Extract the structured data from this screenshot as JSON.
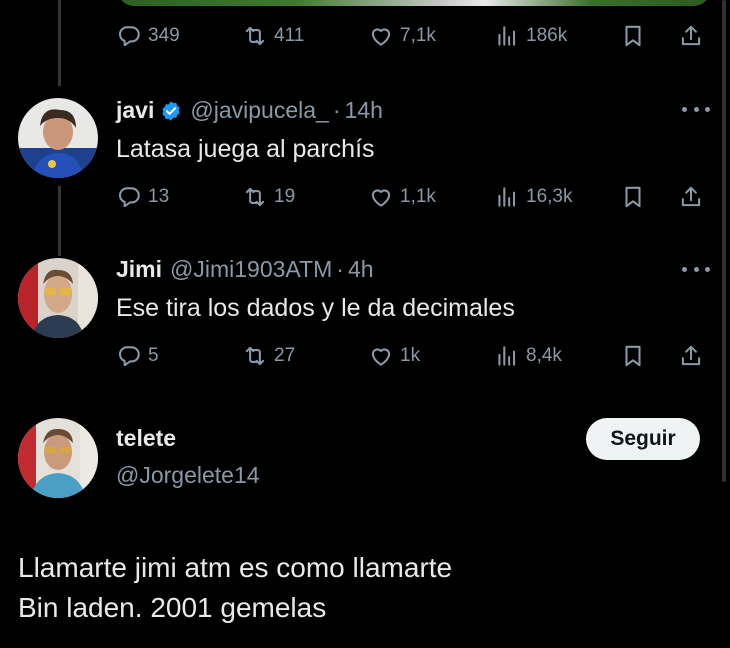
{
  "top_tweet": {
    "stats": {
      "replies": "349",
      "retweets": "411",
      "likes": "7,1k",
      "views": "186k"
    }
  },
  "replies": [
    {
      "display_name": "javi",
      "verified": true,
      "handle": "@javipucela_",
      "separator": "·",
      "time": "14h",
      "text": "Latasa juega al parchís",
      "stats": {
        "replies": "13",
        "retweets": "19",
        "likes": "1,1k",
        "views": "16,3k"
      }
    },
    {
      "display_name": "Jimi",
      "verified": false,
      "handle": "@Jimi1903ATM",
      "separator": "·",
      "time": "4h",
      "text": "Ese tira los dados y le da decimales",
      "stats": {
        "replies": "5",
        "retweets": "27",
        "likes": "1k",
        "views": "8,4k"
      }
    }
  ],
  "main_tweet": {
    "display_name": "telete",
    "handle": "@Jorgelete14",
    "follow_label": "Seguir",
    "text_line1": "Llamarte jimi atm es como llamarte",
    "text_line2": "Bin laden. 2001 gemelas"
  },
  "icons": {
    "reply": "reply-icon",
    "retweet": "retweet-icon",
    "like": "heart-icon",
    "views": "views-icon",
    "bookmark": "bookmark-icon",
    "share": "share-icon",
    "verified": "verified-badge-icon",
    "more": "more-icon"
  },
  "colors": {
    "background": "#000000",
    "text": "#e7e9ea",
    "muted": "#8b98a5",
    "verified": "#1d9bf0",
    "follow_bg": "#eff3f4"
  }
}
